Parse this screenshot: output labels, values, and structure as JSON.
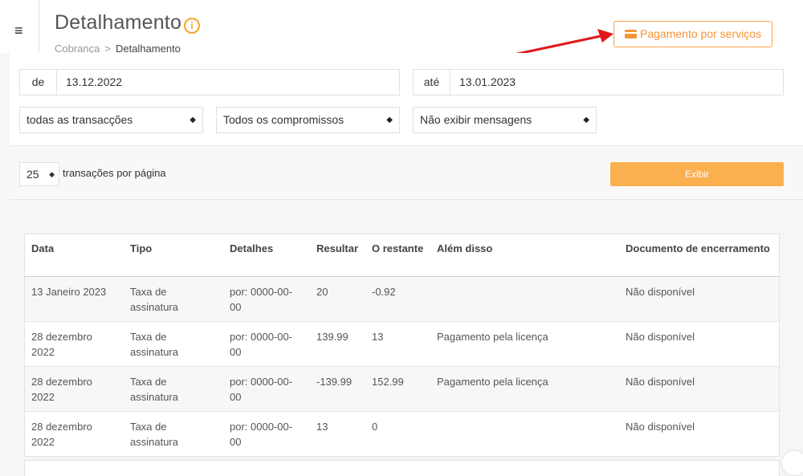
{
  "header": {
    "title": "Detalhamento",
    "info_glyph": "i",
    "breadcrumb": [
      "Cobrança",
      "Detalhamento"
    ],
    "breadcrumb_separator": ">",
    "pay_button_label": "Pagamento por serviços",
    "menu_glyph": "≡"
  },
  "filters": {
    "from_label": "de",
    "from_value": "13.12.2022",
    "to_label": "até",
    "to_value": "13.01.2023",
    "transactions_select": "todas as transacções",
    "commitments_select": "Todos os compromissos",
    "messages_select": "Não exibir mensagens",
    "caret_glyph": "◆"
  },
  "pagination": {
    "per_page_value": "25",
    "per_page_text": "transações por página",
    "show_button_label": "Exibir"
  },
  "table": {
    "columns": [
      "Data",
      "Tipo",
      "Detalhes",
      "Resultar",
      "O restante",
      "Além disso",
      "Documento de encerramento"
    ],
    "rows": [
      [
        "13 Janeiro 2023",
        "Taxa de assinatura",
        "por: 0000-00-00",
        "20",
        "-0.92",
        "",
        "Não disponível"
      ],
      [
        "28 dezembro 2022",
        "Taxa de assinatura",
        "por: 0000-00-00",
        "139.99",
        "13",
        "Pagamento pela licença",
        "Não disponível"
      ],
      [
        "28 dezembro 2022",
        "Taxa de assinatura",
        "por: 0000-00-00",
        "-139.99",
        "152.99",
        "Pagamento pela licença",
        "Não disponível"
      ],
      [
        "28 dezembro 2022",
        "Taxa de assinatura",
        "por: 0000-00-00",
        "13",
        "0",
        "",
        "Não disponível"
      ]
    ]
  },
  "colors": {
    "accent": "#f59438",
    "button": "#fbb04f",
    "arrow": "#e0181b"
  },
  "icons": {
    "menu": "hamburger-menu-icon",
    "info": "info-circle-icon",
    "payment": "credit-card-icon",
    "annotation": "red-arrow-icon"
  }
}
